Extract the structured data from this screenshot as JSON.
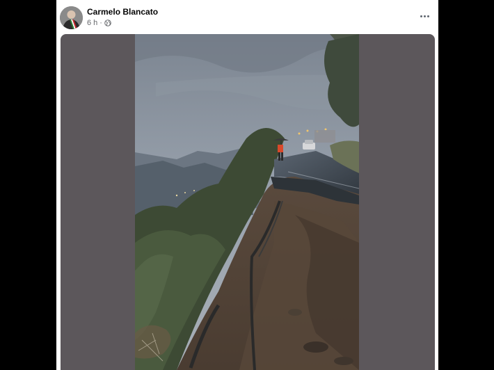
{
  "post": {
    "author": "Carmelo Blancato",
    "time": "6 h",
    "separator": "·",
    "privacy_icon": "globe-icon",
    "more_icon": "more-options-icon"
  },
  "media": {
    "type": "photo",
    "background_color": "#5c575b"
  },
  "colors": {
    "author_text": "#050505",
    "meta_text": "#65676b",
    "card_bg": "#ffffff"
  }
}
